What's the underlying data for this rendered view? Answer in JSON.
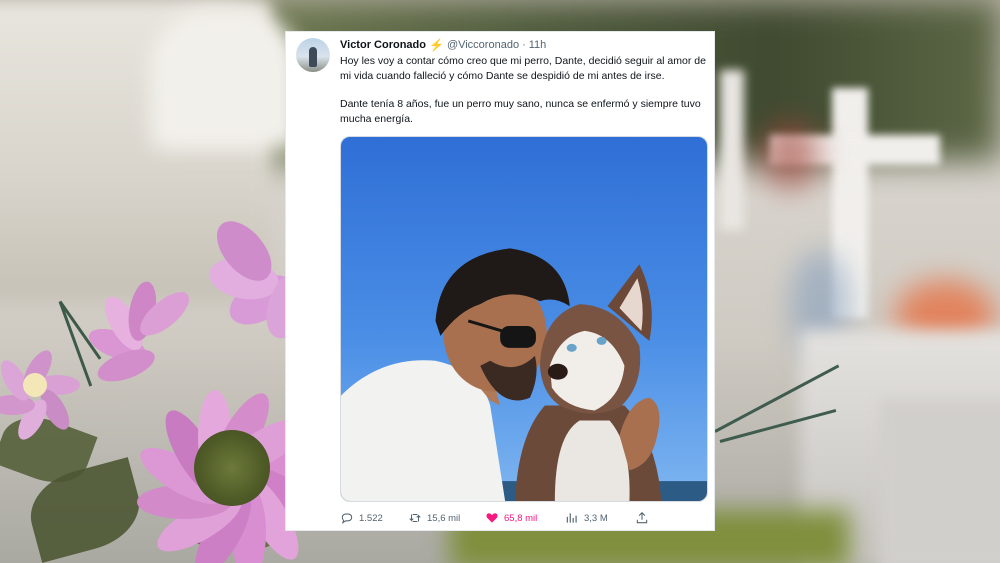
{
  "tweet": {
    "author_name": "Victor Coronado",
    "verified_badge_icon": "lightning-bolt-icon",
    "handle": "@Viccoronado",
    "separator": "·",
    "time": "11h",
    "text_paragraph_1": "Hoy les voy a contar cómo creo que mi perro, Dante, decidió seguir al amor de mi vida cuando falleció y cómo Dante se despidió de mi antes de irse.",
    "text_paragraph_2": "Dante tenía 8 años, fue un perro muy sano, nunca se enfermó y siempre tuvo mucha energía.",
    "actions": {
      "replies": "1.522",
      "retweets": "15,6 mil",
      "likes": "65,8 mil",
      "views": "3,3 M"
    }
  },
  "colors": {
    "like_active": "#f91880",
    "muted_text": "#536471",
    "text": "#0f1419",
    "bolt": "#f2b705"
  }
}
